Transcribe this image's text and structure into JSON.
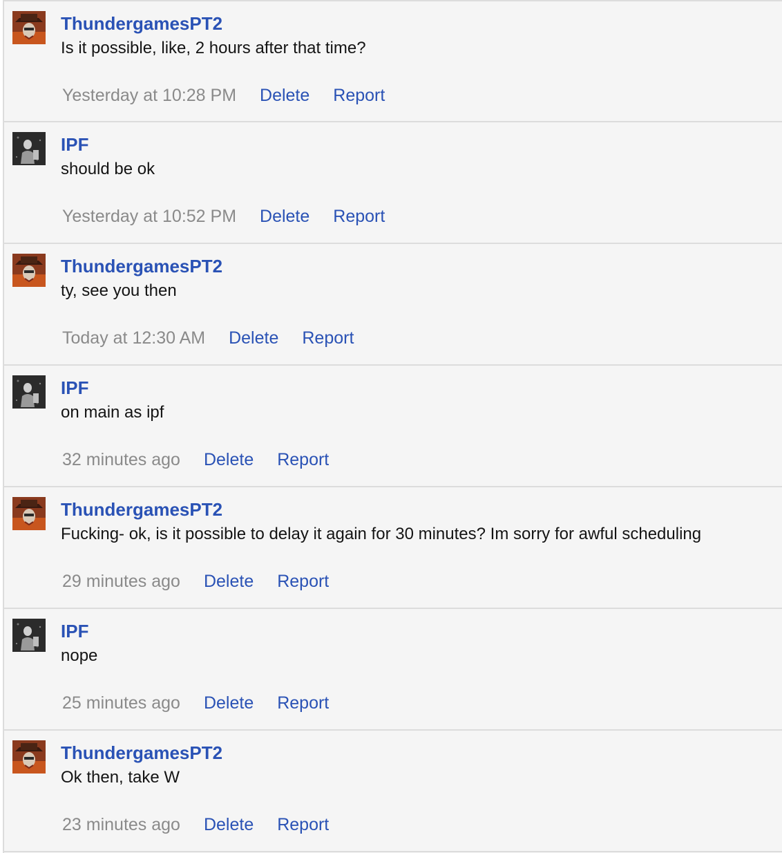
{
  "colors": {
    "link": "#2a52b5",
    "timestamp": "#8a8a8a",
    "text": "#141414",
    "background": "#f5f5f5",
    "divider": "#dcdcdc"
  },
  "messages": [
    {
      "author": "ThundergamesPT2",
      "avatar": "hat-avatar-icon",
      "text": "Is it possible, like, 2 hours after that time?",
      "time": "Yesterday at 10:28 PM",
      "delete_label": "Delete",
      "report_label": "Report"
    },
    {
      "author": "IPF",
      "avatar": "dark-avatar-icon",
      "text": "should be ok",
      "time": "Yesterday at 10:52 PM",
      "delete_label": "Delete",
      "report_label": "Report"
    },
    {
      "author": "ThundergamesPT2",
      "avatar": "hat-avatar-icon",
      "text": "ty, see you then",
      "time": "Today at 12:30 AM",
      "delete_label": "Delete",
      "report_label": "Report"
    },
    {
      "author": "IPF",
      "avatar": "dark-avatar-icon",
      "text": "on main as ipf",
      "time": "32 minutes ago",
      "delete_label": "Delete",
      "report_label": "Report"
    },
    {
      "author": "ThundergamesPT2",
      "avatar": "hat-avatar-icon",
      "text": "Fucking- ok, is it possible to delay it again for 30 minutes? Im sorry for awful scheduling",
      "time": "29 minutes ago",
      "delete_label": "Delete",
      "report_label": "Report"
    },
    {
      "author": "IPF",
      "avatar": "dark-avatar-icon",
      "text": "nope",
      "time": "25 minutes ago",
      "delete_label": "Delete",
      "report_label": "Report"
    },
    {
      "author": "ThundergamesPT2",
      "avatar": "hat-avatar-icon",
      "text": "Ok then, take W",
      "time": "23 minutes ago",
      "delete_label": "Delete",
      "report_label": "Report"
    }
  ]
}
